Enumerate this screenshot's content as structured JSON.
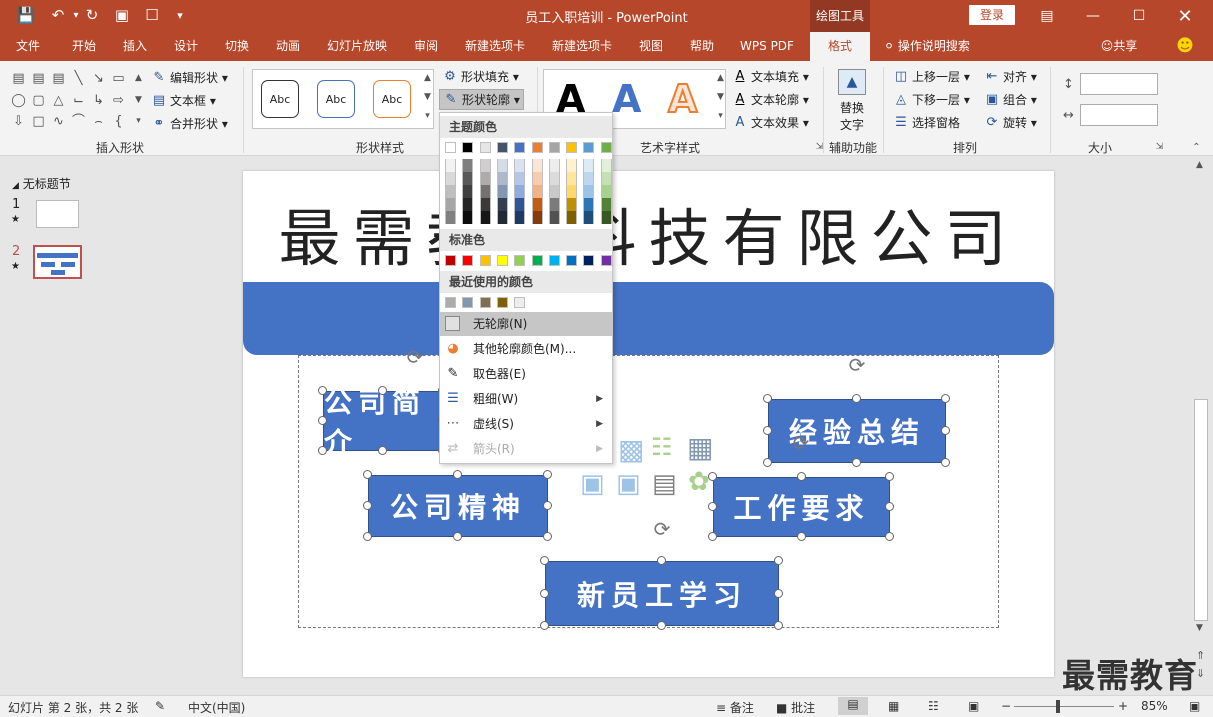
{
  "window": {
    "title": "员工入职培训 - PowerPoint",
    "context_group": "绘图工具",
    "login": "登录"
  },
  "tabs": [
    {
      "label": "文件"
    },
    {
      "label": "开始"
    },
    {
      "label": "插入"
    },
    {
      "label": "设计"
    },
    {
      "label": "切换"
    },
    {
      "label": "动画"
    },
    {
      "label": "幻灯片放映"
    },
    {
      "label": "审阅"
    },
    {
      "label": "新建选项卡"
    },
    {
      "label": "新建选项卡"
    },
    {
      "label": "视图"
    },
    {
      "label": "帮助"
    },
    {
      "label": "WPS PDF"
    },
    {
      "label": "格式"
    }
  ],
  "tell_me": "操作说明搜索",
  "share": "共享",
  "ribbon": {
    "insert_shapes": {
      "label": "插入形状",
      "edit_shape": "编辑形状",
      "text_box": "文本框",
      "merge_shapes": "合并形状"
    },
    "shape_styles": {
      "label": "形状样式",
      "sample": "Abc",
      "fill": "形状填充",
      "outline": "形状轮廓"
    },
    "wordart": {
      "label": "艺术字样式",
      "sample": "A",
      "text_fill": "文本填充",
      "text_outline": "文本轮廓",
      "text_effects": "文本效果"
    },
    "accessibility": {
      "label": "辅助功能",
      "alt_text_line1": "替换",
      "alt_text_line2": "文字"
    },
    "arrange": {
      "label": "排列",
      "bring_forward": "上移一层",
      "send_backward": "下移一层",
      "selection_pane": "选择窗格",
      "align": "对齐",
      "group": "组合",
      "rotate": "旋转"
    },
    "size": {
      "label": "大小"
    }
  },
  "outline_menu": {
    "theme_colors": "主题颜色",
    "standard_colors": "标准色",
    "recent_colors": "最近使用的颜色",
    "no_outline": "无轮廓(N)",
    "more_colors": "其他轮廓颜色(M)...",
    "eyedropper": "取色器(E)",
    "weight": "粗细(W)",
    "dashes": "虚线(S)",
    "arrows": "箭头(R)",
    "theme_row": [
      "#ffffff",
      "#000000",
      "#e7e6e6",
      "#44546a",
      "#4472c4",
      "#ed7d31",
      "#a5a5a5",
      "#ffc000",
      "#5b9bd5",
      "#70ad47"
    ],
    "theme_shades": [
      [
        "#f2f2f2",
        "#7f7f7f",
        "#d0cece",
        "#d6dce5",
        "#d9e2f3",
        "#fbe5d6",
        "#ededed",
        "#fff2cc",
        "#deebf7",
        "#e2f0d9"
      ],
      [
        "#d9d9d9",
        "#595959",
        "#aeabab",
        "#adb9ca",
        "#b4c7e7",
        "#f8cbad",
        "#dbdbdb",
        "#ffe699",
        "#bdd7ee",
        "#c5e0b4"
      ],
      [
        "#bfbfbf",
        "#404040",
        "#757171",
        "#8497b0",
        "#8faadc",
        "#f4b183",
        "#c9c9c9",
        "#ffd966",
        "#9dc3e6",
        "#a9d18e"
      ],
      [
        "#a6a6a6",
        "#262626",
        "#3b3838",
        "#333f50",
        "#2f5597",
        "#c55a11",
        "#7b7b7b",
        "#bf9000",
        "#2e75b6",
        "#548235"
      ],
      [
        "#808080",
        "#0d0d0d",
        "#171616",
        "#222a35",
        "#1f3864",
        "#843c0c",
        "#525252",
        "#7f6000",
        "#1f4e79",
        "#385723"
      ]
    ],
    "standard_row": [
      "#c00000",
      "#ff0000",
      "#ffc000",
      "#ffff00",
      "#92d050",
      "#00b050",
      "#00b0f0",
      "#0070c0",
      "#002060",
      "#7030a0"
    ],
    "recent_row": [
      "#aeabab",
      "#8497b0",
      "#7f6f4f",
      "#7f6000",
      "#ededed"
    ]
  },
  "slides_pane": {
    "section": "无标题节",
    "slides": [
      {
        "num": "1"
      },
      {
        "num": "2"
      }
    ]
  },
  "slide": {
    "title": "最需教育科技有限公司",
    "boxes": {
      "intro": "公司简介",
      "spirit": "公司精神",
      "summary": "经验总结",
      "requirements": "工作要求",
      "learning": "新员工学习"
    }
  },
  "status": {
    "slide_info": "幻灯片 第 2 张，共 2 张",
    "language": "中文(中国)",
    "notes": "备注",
    "comments": "批注",
    "zoom": "85%"
  },
  "watermark": "最需教育",
  "colors": {
    "accent": "#b7472a",
    "box_blue": "#4472c4"
  }
}
